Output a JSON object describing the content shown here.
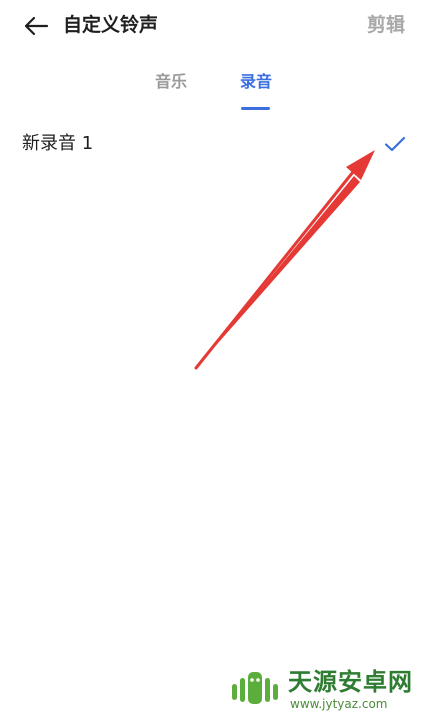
{
  "header": {
    "back_icon": "arrow-left-icon",
    "title": "自定义铃声",
    "edit_label": "剪辑"
  },
  "tabs": [
    {
      "label": "音乐",
      "selected": false
    },
    {
      "label": "录音",
      "selected": true
    }
  ],
  "recordings": [
    {
      "label": "新录音 1",
      "selected": true,
      "icon": "check-icon"
    }
  ],
  "colors": {
    "accent": "#3b6fe0",
    "text_primary": "#1f1f1f",
    "text_disabled": "#a8a8a8",
    "annotation_arrow": "#e53935",
    "watermark_green": "#2e7d32"
  },
  "watermark": {
    "name": "天源安卓网",
    "url": "www.jytyaz.com"
  }
}
